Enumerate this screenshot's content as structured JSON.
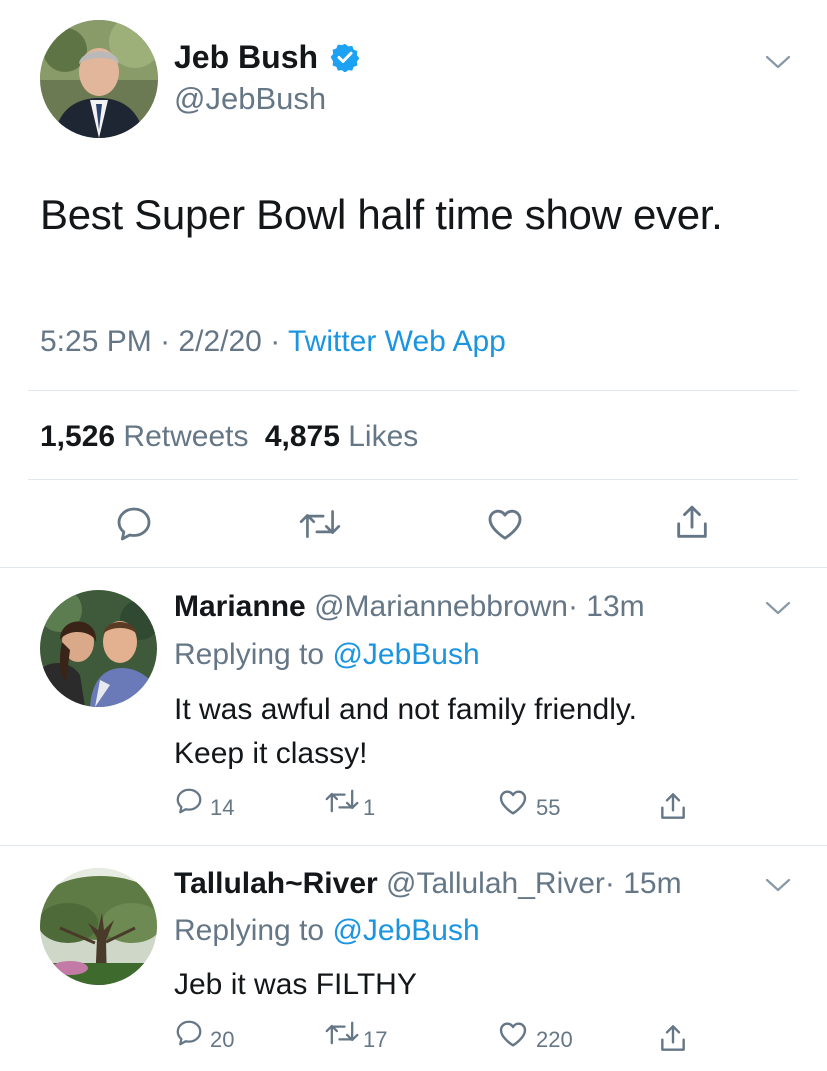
{
  "main_tweet": {
    "author": {
      "name": "Jeb Bush",
      "handle": "@JebBush",
      "verified": true
    },
    "text": "Best Super Bowl half time show ever.",
    "time": "5:25 PM",
    "date": "2/2/20",
    "dot": "·",
    "source": "Twitter Web App",
    "stats": {
      "retweets_count": "1,526",
      "retweets_label": "Retweets",
      "likes_count": "4,875",
      "likes_label": "Likes"
    }
  },
  "replies": [
    {
      "name": "Marianne",
      "handle": "@Mariannebbrown",
      "time": "· 13m",
      "replying_prefix": "Replying to",
      "replying_to": "@JebBush",
      "text_line1": "It was awful and not family friendly.",
      "text_line2": "Keep it classy!",
      "replies": "14",
      "retweets": "1",
      "likes": "55"
    },
    {
      "name": "Tallulah~River",
      "handle": "@Tallulah_River",
      "time": "· 15m",
      "replying_prefix": "Replying to",
      "replying_to": "@JebBush",
      "text_line1": "Jeb it was FILTHY",
      "replies": "20",
      "retweets": "17",
      "likes": "220"
    }
  ],
  "icons": {
    "verified": "verified-badge-icon",
    "more": "chevron-down-icon",
    "reply": "comment-icon",
    "retweet": "retweet-icon",
    "like": "heart-icon",
    "share": "share-icon"
  },
  "colors": {
    "text": "#14171a",
    "secondary": "#657786",
    "link": "#1b95e0",
    "verified": "#1da1f2",
    "divider": "#e1e8ed"
  }
}
